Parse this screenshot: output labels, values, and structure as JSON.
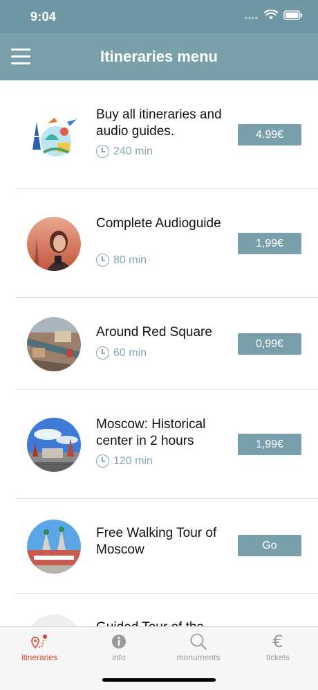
{
  "status": {
    "time": "9:04"
  },
  "header": {
    "title": "Itineraries menu"
  },
  "items": [
    {
      "title": "Buy all itineraries and audio guides.",
      "duration": "240 min",
      "price": "4.99€"
    },
    {
      "title": "Complete Audioguide",
      "duration": "80 min",
      "price": "1,99€"
    },
    {
      "title": "Around Red Square",
      "duration": "60 min",
      "price": "0,99€"
    },
    {
      "title": "Moscow: Historical center in 2 hours",
      "duration": "120 min",
      "price": "1,99€"
    },
    {
      "title": "Free Walking Tour of Moscow",
      "duration": "",
      "price": "Go"
    },
    {
      "title": "Guided Tour of the",
      "duration": "",
      "price": ""
    }
  ],
  "tabs": [
    {
      "label": "itineraries",
      "icon": "map-pin-route-icon",
      "active": true
    },
    {
      "label": "info",
      "icon": "info-icon",
      "active": false
    },
    {
      "label": "monuments",
      "icon": "search-icon",
      "active": false
    },
    {
      "label": "tickets",
      "icon": "euro-icon",
      "active": false
    }
  ],
  "colors": {
    "header": "#79a0aa",
    "status_bar": "#6e97a3",
    "accent_active": "#d9442e",
    "button": "#79a0aa"
  }
}
